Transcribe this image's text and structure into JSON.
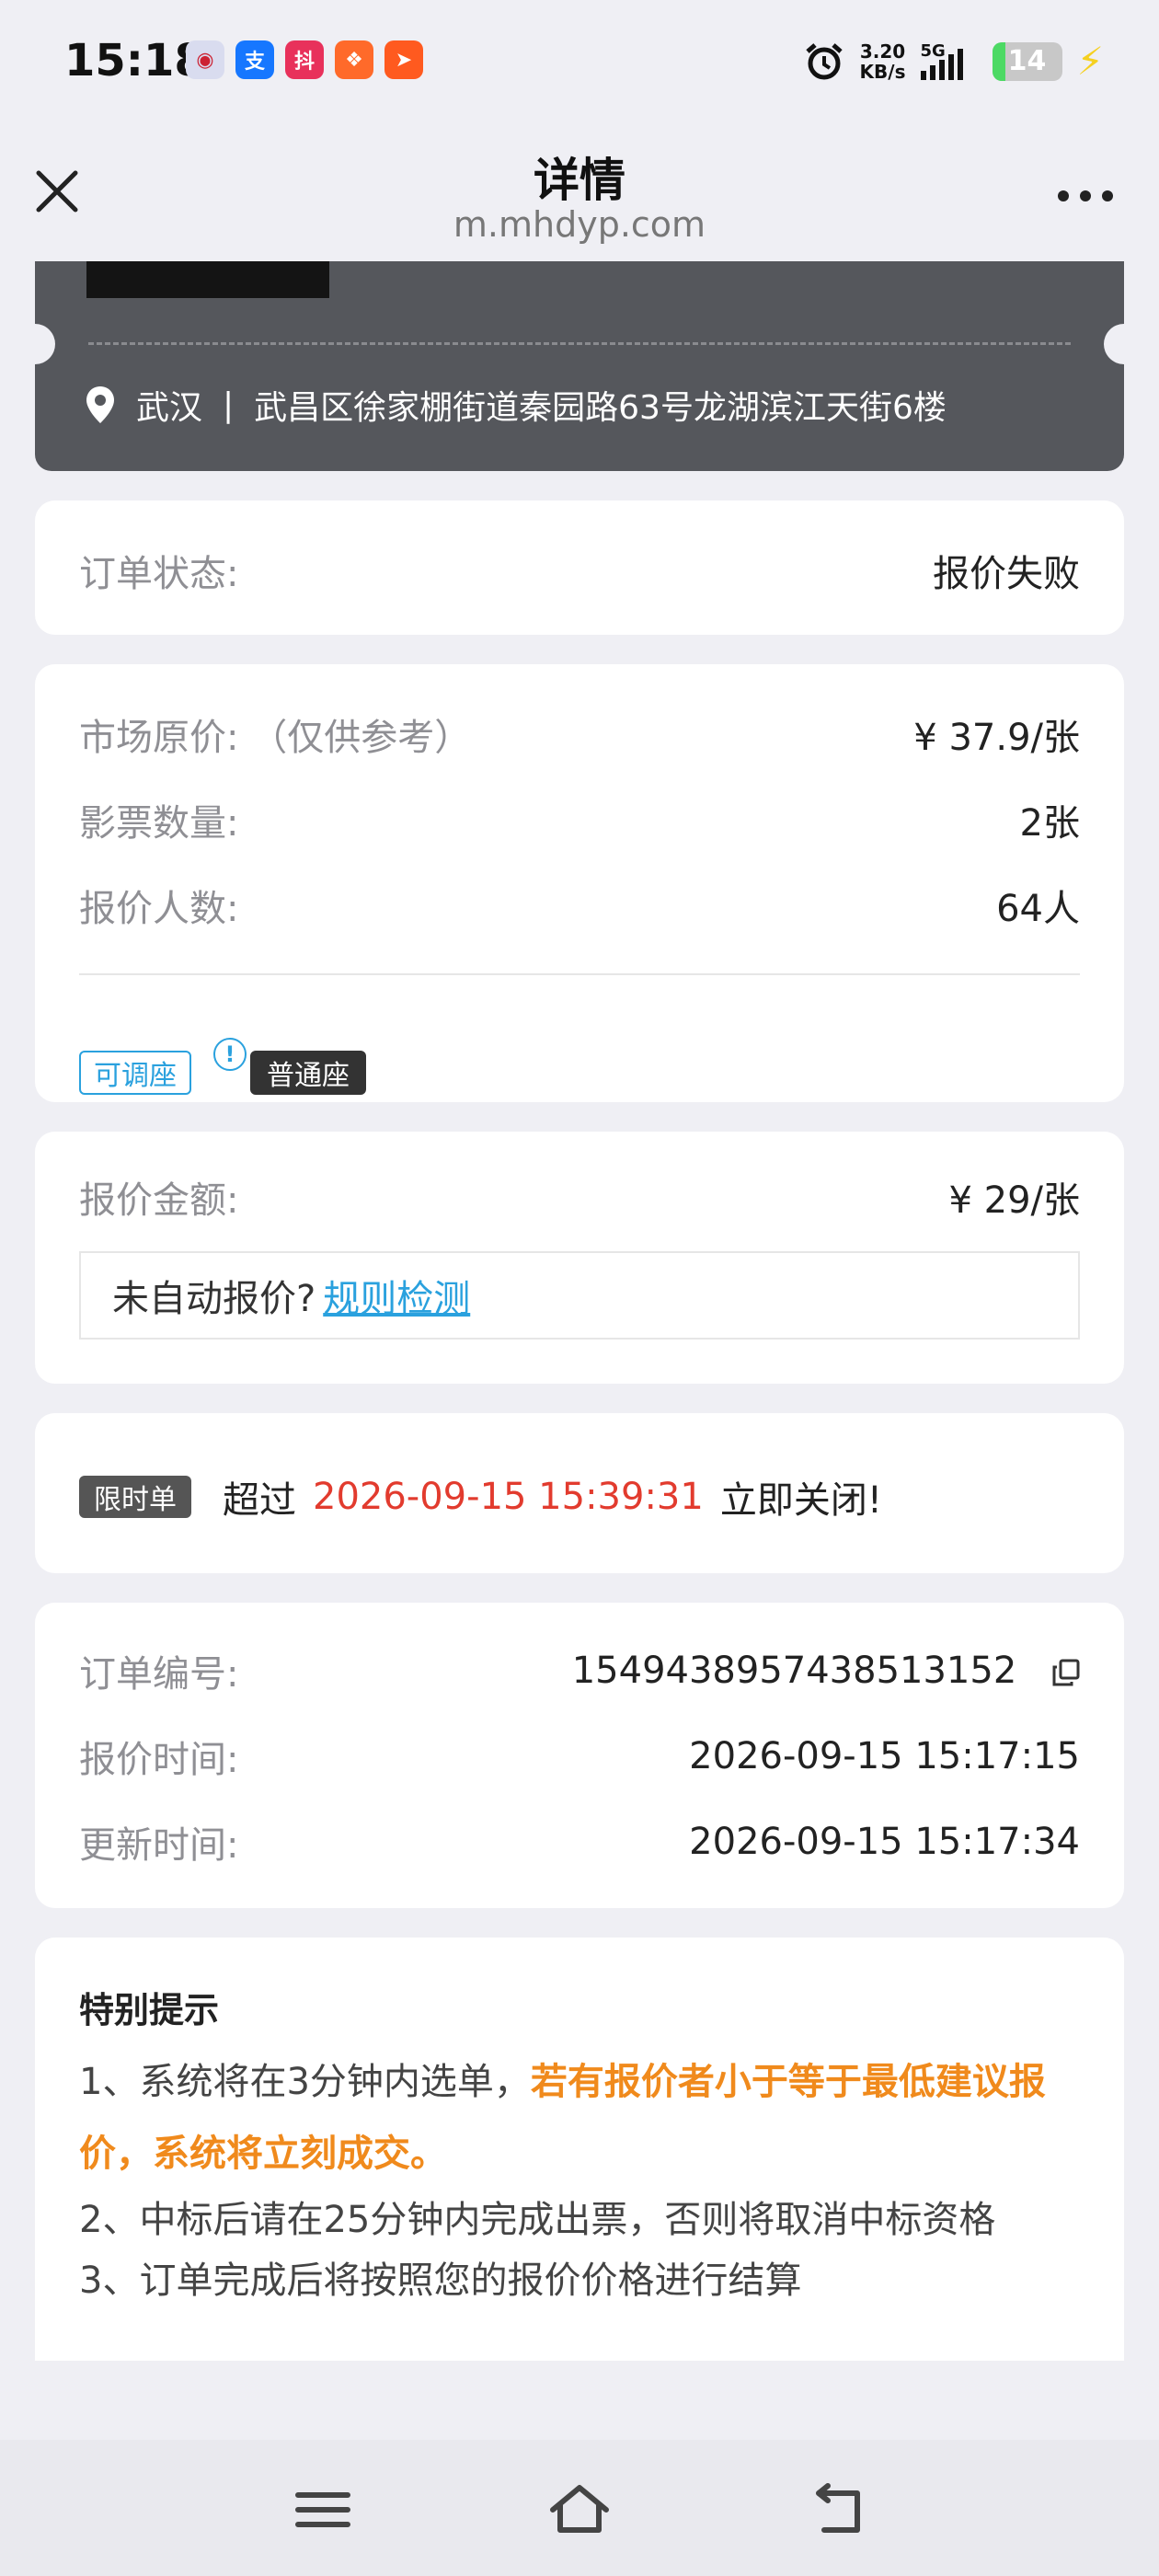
{
  "status_bar": {
    "time": "15:18",
    "apps": [
      {
        "icon": "bank-app-icon",
        "color": "#d9dcef",
        "glyph": "◉"
      },
      {
        "icon": "alipay-app-icon",
        "color": "#1677ff",
        "glyph": "支"
      },
      {
        "icon": "douyin-app-icon",
        "color": "#e8315b",
        "glyph": "抖"
      },
      {
        "icon": "app-orange-icon",
        "color": "#ff6a2a",
        "glyph": "❖"
      },
      {
        "icon": "app-send-icon",
        "color": "#ff5a1f",
        "glyph": "➤"
      }
    ],
    "net_speed_value": "3.20",
    "net_speed_unit": "KB/s",
    "signal_label": "5G",
    "battery": "14"
  },
  "nav": {
    "title": "详情",
    "url": "m.mhdyp.com"
  },
  "cinema": {
    "city": "武汉",
    "separator": "|",
    "address": "武昌区徐家棚街道秦园路63号龙湖滨江天街6楼"
  },
  "order_status": {
    "label": "订单状态:",
    "value": "报价失败"
  },
  "price_info": {
    "market_price_label": "市场原价: （仅供参考）",
    "market_price_value": "¥ 37.9/张",
    "ticket_count_label": "影票数量:",
    "ticket_count_value": "2张",
    "bidders_label": "报价人数:",
    "bidders_value": "64人",
    "tag_adjust": "可调座",
    "tag_info": "!",
    "tag_seat": "普通座"
  },
  "quote": {
    "label": "报价金额:",
    "value": "¥ 29/张",
    "rule_text": "未自动报价?",
    "rule_link": "规则检测"
  },
  "limit": {
    "badge": "限时单",
    "prefix": "超过",
    "time": "2026-09-15 15:39:31",
    "suffix": "立即关闭!"
  },
  "order_meta": {
    "order_no_label": "订单编号:",
    "order_no_value": "1549438957438513152",
    "quote_time_label": "报价时间:",
    "quote_time_value": "2026-09-15 15:17:15",
    "update_time_label": "更新时间:",
    "update_time_value": "2026-09-15 15:17:34"
  },
  "tips": {
    "title": "特别提示",
    "line1_prefix": "1、系统将在3分钟内选单，",
    "line1_highlight": "若有报价者小于等于最低建议报价，系统将立刻成交。",
    "line2": "2、中标后请在25分钟内完成出票，否则将取消中标资格",
    "line3": "3、订单完成后将按照您的报价价格进行结算"
  },
  "colors": {
    "accent_blue": "#2aa1de",
    "price_red": "#e23b2e",
    "highlight_orange": "#f08a1c",
    "dark_card": "#55575c"
  }
}
